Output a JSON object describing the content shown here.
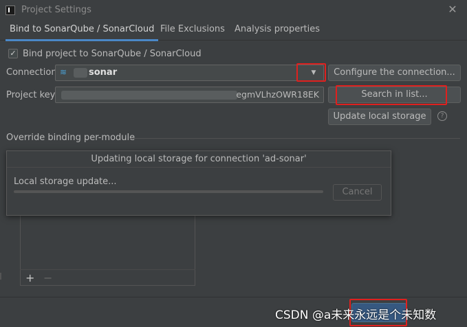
{
  "window": {
    "title": "Project Settings",
    "icon": "intellij-app-icon"
  },
  "tabs": [
    {
      "label": "Bind to SonarQube / SonarCloud",
      "active": true
    },
    {
      "label": "File Exclusions",
      "active": false
    },
    {
      "label": "Analysis properties",
      "active": false
    }
  ],
  "binding": {
    "checkbox_label": "Bind project to SonarQube / SonarCloud",
    "checked": true,
    "connection_label": "Connection:",
    "connection_value": "sonar",
    "configure_button": "Configure the connection...",
    "project_key_label": "Project key:",
    "project_key_value": "egmVLhzOWR18EK",
    "search_button": "Search in list...",
    "update_button": "Update local storage"
  },
  "override": {
    "label": "Override binding per-module",
    "add": "+",
    "remove": "−"
  },
  "progress": {
    "title": "Updating local storage for connection 'ad-sonar'",
    "text": "Local storage update...",
    "cancel_button": "Cancel",
    "fraction": 0
  },
  "watermark": "CSDN @a未来永远是个未知数",
  "colors": {
    "background": "#3c3f41",
    "accent": "#4a88c7",
    "highlight_box": "#e0201e"
  }
}
